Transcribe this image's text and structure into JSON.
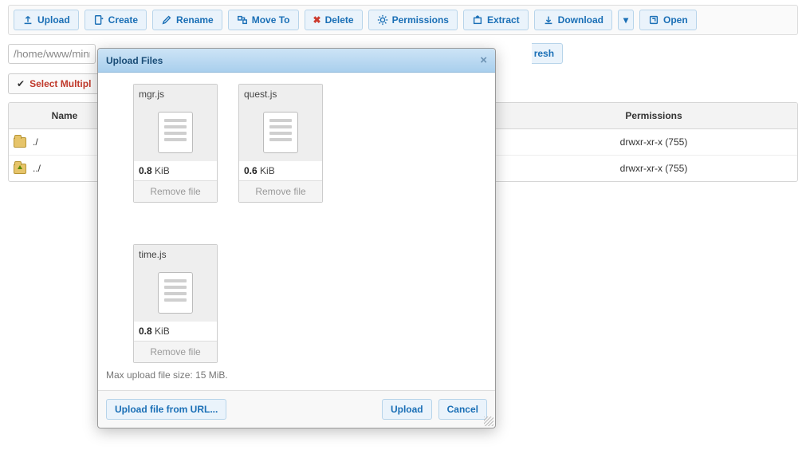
{
  "toolbar": {
    "upload": "Upload",
    "create": "Create",
    "rename": "Rename",
    "moveto": "Move To",
    "delete": "Delete",
    "permissions": "Permissions",
    "extract": "Extract",
    "download": "Download",
    "open": "Open"
  },
  "path": {
    "value": "/home/www/minn"
  },
  "refresh_suffix": "resh",
  "select_multiple_partial": "Select Multipl",
  "table": {
    "headers": {
      "name": "Name",
      "permissions": "Permissions"
    },
    "rows": [
      {
        "name": "./",
        "icon": "folder",
        "permissions": "drwxr-xr-x (755)"
      },
      {
        "name": "../",
        "icon": "folder-up",
        "permissions": "drwxr-xr-x (755)"
      }
    ]
  },
  "modal": {
    "title": "Upload Files",
    "files": [
      {
        "name": "mgr.js",
        "size_value": "0.8",
        "size_unit": "KiB",
        "remove": "Remove file"
      },
      {
        "name": "quest.js",
        "size_value": "0.6",
        "size_unit": "KiB",
        "remove": "Remove file"
      },
      {
        "name": "time.js",
        "size_value": "0.8",
        "size_unit": "KiB",
        "remove": "Remove file"
      }
    ],
    "max_line": "Max upload file size: 15 MiB.",
    "upload_from_url": "Upload file from URL...",
    "upload": "Upload",
    "cancel": "Cancel"
  }
}
